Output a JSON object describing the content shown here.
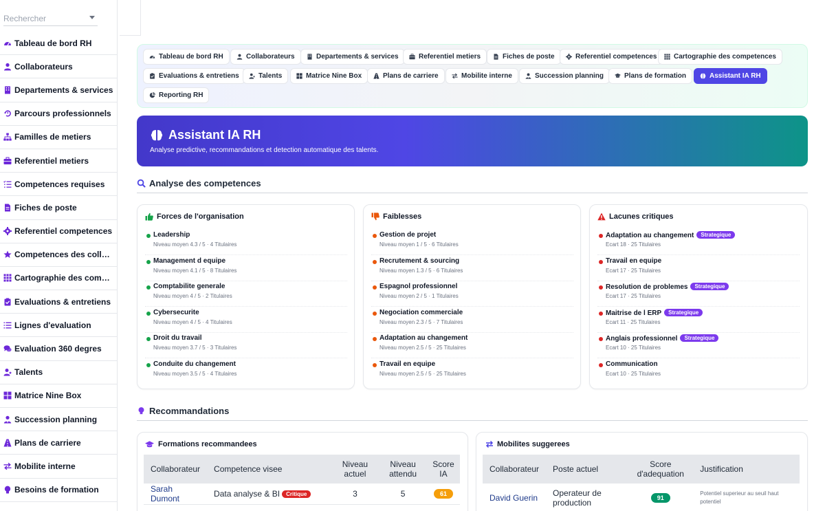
{
  "search": {
    "placeholder": "Rechercher"
  },
  "sidebar": {
    "items": [
      {
        "label": "Tableau de bord RH",
        "icon": "gauge-icon"
      },
      {
        "label": "Collaborateurs",
        "icon": "user-icon"
      },
      {
        "label": "Departements & services",
        "icon": "building-icon"
      },
      {
        "label": "Parcours professionnels",
        "icon": "history-icon"
      },
      {
        "label": "Familles de metiers",
        "icon": "sitemap-icon"
      },
      {
        "label": "Referentiel metiers",
        "icon": "briefcase-icon"
      },
      {
        "label": "Competences requises",
        "icon": "list-check-icon"
      },
      {
        "label": "Fiches de poste",
        "icon": "file-icon"
      },
      {
        "label": "Referentiel competences",
        "icon": "gear-icon"
      },
      {
        "label": "Competences des collaborateurs",
        "icon": "star-icon"
      },
      {
        "label": "Cartographie des competences",
        "icon": "grid-icon"
      },
      {
        "label": "Evaluations & entretiens",
        "icon": "clipboard-check-icon"
      },
      {
        "label": "Lignes d'evaluation",
        "icon": "list-icon"
      },
      {
        "label": "Evaluation 360 degres",
        "icon": "comments-icon"
      },
      {
        "label": "Talents",
        "icon": "user-star-icon"
      },
      {
        "label": "Matrice Nine Box",
        "icon": "table-grid-icon"
      },
      {
        "label": "Succession planning",
        "icon": "user-tie-icon"
      },
      {
        "label": "Plans de carriere",
        "icon": "route-icon"
      },
      {
        "label": "Mobilite interne",
        "icon": "exchange-icon"
      },
      {
        "label": "Besoins de formation",
        "icon": "lightbulb-icon"
      }
    ]
  },
  "tabs": [
    {
      "label": "Tableau de bord RH",
      "icon": "gauge-icon"
    },
    {
      "label": "Collaborateurs",
      "icon": "user-icon"
    },
    {
      "label": "Departements & services",
      "icon": "building-icon"
    },
    {
      "label": "Referentiel metiers",
      "icon": "briefcase-icon"
    },
    {
      "label": "Fiches de poste",
      "icon": "file-icon"
    },
    {
      "label": "Referentiel competences",
      "icon": "gear-icon"
    },
    {
      "label": "Cartographie des competences",
      "icon": "grid-icon"
    },
    {
      "label": "Evaluations & entretiens",
      "icon": "clipboard-check-icon"
    },
    {
      "label": "Talents",
      "icon": "user-star-icon"
    },
    {
      "label": "Matrice Nine Box",
      "icon": "table-grid-icon"
    },
    {
      "label": "Plans de carriere",
      "icon": "route-icon"
    },
    {
      "label": "Mobilite interne",
      "icon": "exchange-icon"
    },
    {
      "label": "Succession planning",
      "icon": "user-tie-icon"
    },
    {
      "label": "Plans de formation",
      "icon": "graduation-cap-icon"
    },
    {
      "label": "Assistant IA RH",
      "icon": "brain-icon",
      "active": true
    },
    {
      "label": "Reporting RH",
      "icon": "pie-chart-icon"
    }
  ],
  "hero": {
    "title": "Assistant IA RH",
    "subtitle": "Analyse predictive, recommandations et detection automatique des talents."
  },
  "analysis": {
    "title": "Analyse des competences",
    "strengths": {
      "title": "Forces de l'organisation",
      "items": [
        {
          "name": "Leadership",
          "detail": "Niveau moyen 4.3 / 5 · 4 Titulaires"
        },
        {
          "name": "Management d equipe",
          "detail": "Niveau moyen 4.1 / 5 · 8 Titulaires"
        },
        {
          "name": "Comptabilite generale",
          "detail": "Niveau moyen 4 / 5 · 2 Titulaires"
        },
        {
          "name": "Cybersecurite",
          "detail": "Niveau moyen 4 / 5 · 4 Titulaires"
        },
        {
          "name": "Droit du travail",
          "detail": "Niveau moyen 3.7 / 5 · 3 Titulaires"
        },
        {
          "name": "Conduite du changement",
          "detail": "Niveau moyen 3.5 / 5 · 4 Titulaires"
        }
      ]
    },
    "weaknesses": {
      "title": "Faiblesses",
      "items": [
        {
          "name": "Gestion de projet",
          "detail": "Niveau moyen 1 / 5 · 6 Titulaires"
        },
        {
          "name": "Recrutement & sourcing",
          "detail": "Niveau moyen 1.3 / 5 · 6 Titulaires"
        },
        {
          "name": "Espagnol professionnel",
          "detail": "Niveau moyen 2 / 5 · 1 Titulaires"
        },
        {
          "name": "Negociation commerciale",
          "detail": "Niveau moyen 2.3 / 5 · 7 Titulaires"
        },
        {
          "name": "Adaptation au changement",
          "detail": "Niveau moyen 2.5 / 5 · 25 Titulaires"
        },
        {
          "name": "Travail en equipe",
          "detail": "Niveau moyen 2.5 / 5 · 25 Titulaires"
        }
      ]
    },
    "gaps": {
      "title": "Lacunes critiques",
      "items": [
        {
          "name": "Adaptation au changement",
          "detail": "Ecart 18 · 25 Titulaires",
          "badge": "Strategique"
        },
        {
          "name": "Travail en equipe",
          "detail": "Ecart 17 · 25 Titulaires",
          "badge": ""
        },
        {
          "name": "Resolution de problemes",
          "detail": "Ecart 17 · 25 Titulaires",
          "badge": "Strategique"
        },
        {
          "name": "Maitrise de l ERP",
          "detail": "Ecart 11 · 25 Titulaires",
          "badge": "Strategique"
        },
        {
          "name": "Anglais professionnel",
          "detail": "Ecart 10 · 25 Titulaires",
          "badge": "Strategique"
        },
        {
          "name": "Communication",
          "detail": "Ecart 10 · 25 Titulaires",
          "badge": ""
        }
      ]
    }
  },
  "recommendations": {
    "title": "Recommandations",
    "trainings": {
      "title": "Formations recommandees",
      "headers": [
        "Collaborateur",
        "Competence visee",
        "Niveau actuel",
        "Niveau attendu",
        "Score IA"
      ],
      "rows": [
        {
          "name": "Sarah Dumont",
          "skill": "Data analyse & BI",
          "tag": "Critique",
          "current": "3",
          "expected": "5",
          "score": "61"
        }
      ]
    },
    "mobility": {
      "title": "Mobilites suggerees",
      "headers": [
        "Collaborateur",
        "Poste actuel",
        "Score d'adequation",
        "Justification"
      ],
      "rows": [
        {
          "name": "David Guerin",
          "position": "Operateur de production",
          "score": "91",
          "justification": "Potentiel superieur au seuil haut potentiel"
        }
      ]
    }
  },
  "colors": {
    "accent": "#4f46e5",
    "strength_dot": "#16a34a",
    "weakness_dot": "#ea580c",
    "gap_dot": "#dc2626",
    "badge_strategic": "#7c3aed",
    "badge_critical": "#dc2626",
    "score_orange": "#f59e0b",
    "score_green": "#059669"
  }
}
